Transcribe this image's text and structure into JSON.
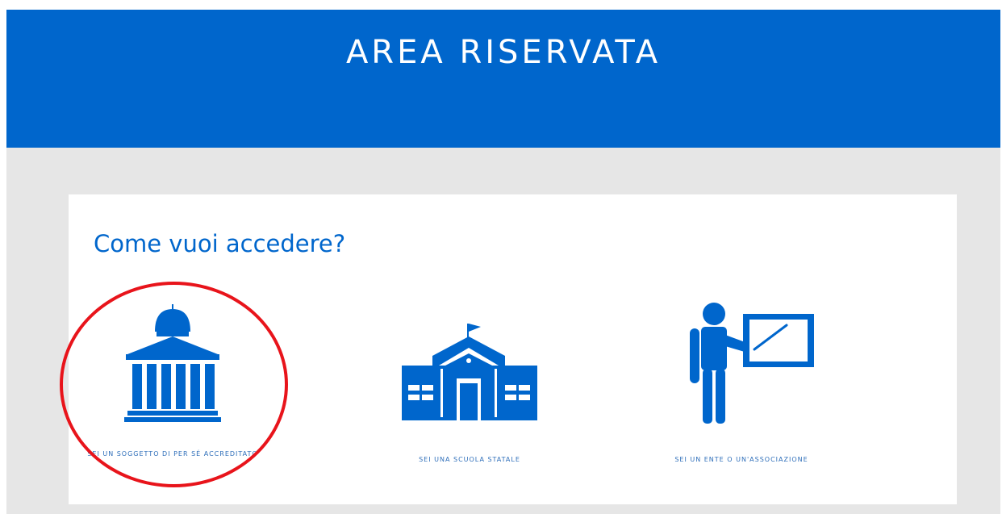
{
  "header": {
    "title": "AREA RISERVATA"
  },
  "card": {
    "title": "Come vuoi accedere?"
  },
  "options": [
    {
      "label": "SEI UN SOGGETTO DI PER SÉ ACCREDITATO",
      "icon": "institution-building-icon"
    },
    {
      "label": "SEI UNA SCUOLA STATALE",
      "icon": "school-building-icon"
    },
    {
      "label": "SEI UN ENTE O UN'ASSOCIAZIONE",
      "icon": "teacher-board-icon"
    }
  ],
  "colors": {
    "brand": "#0066cc",
    "background": "#e6e6e6",
    "highlight": "#e8141b"
  }
}
